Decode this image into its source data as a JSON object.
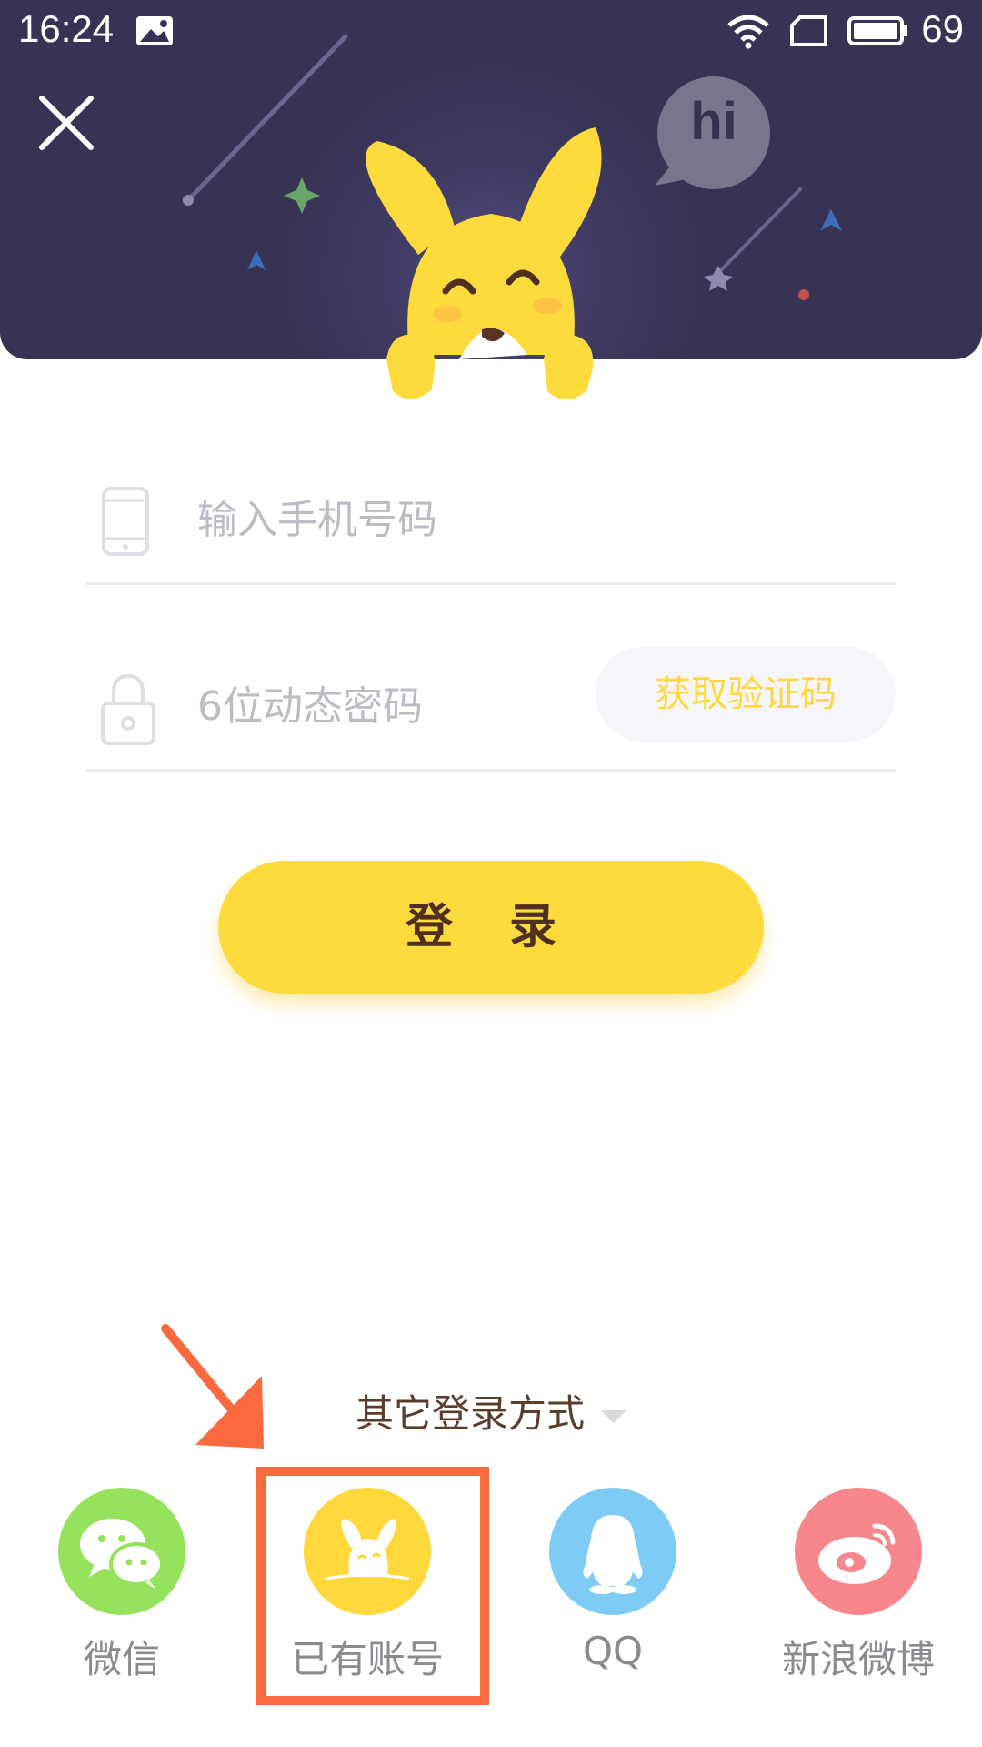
{
  "status_bar": {
    "time": "16:24",
    "battery": "69"
  },
  "header": {
    "bubble_text": "hi"
  },
  "form": {
    "phone_placeholder": "输入手机号码",
    "code_placeholder": "6位动态密码",
    "get_code_label": "获取验证码",
    "login_label": "登 录"
  },
  "other": {
    "title": "其它登录方式",
    "options": [
      {
        "label": "微信",
        "icon": "wechat-icon",
        "color": "#95e35c"
      },
      {
        "label": "已有账号",
        "icon": "kangaroo-icon",
        "color": "#ffd93c"
      },
      {
        "label": "QQ",
        "icon": "qq-penguin-icon",
        "color": "#7ecbf5"
      },
      {
        "label": "新浪微博",
        "icon": "weibo-icon",
        "color": "#f7878c"
      }
    ]
  },
  "colors": {
    "header_bg": "#383355",
    "accent_yellow": "#fedb3c",
    "annotation": "#fb6a3e"
  }
}
